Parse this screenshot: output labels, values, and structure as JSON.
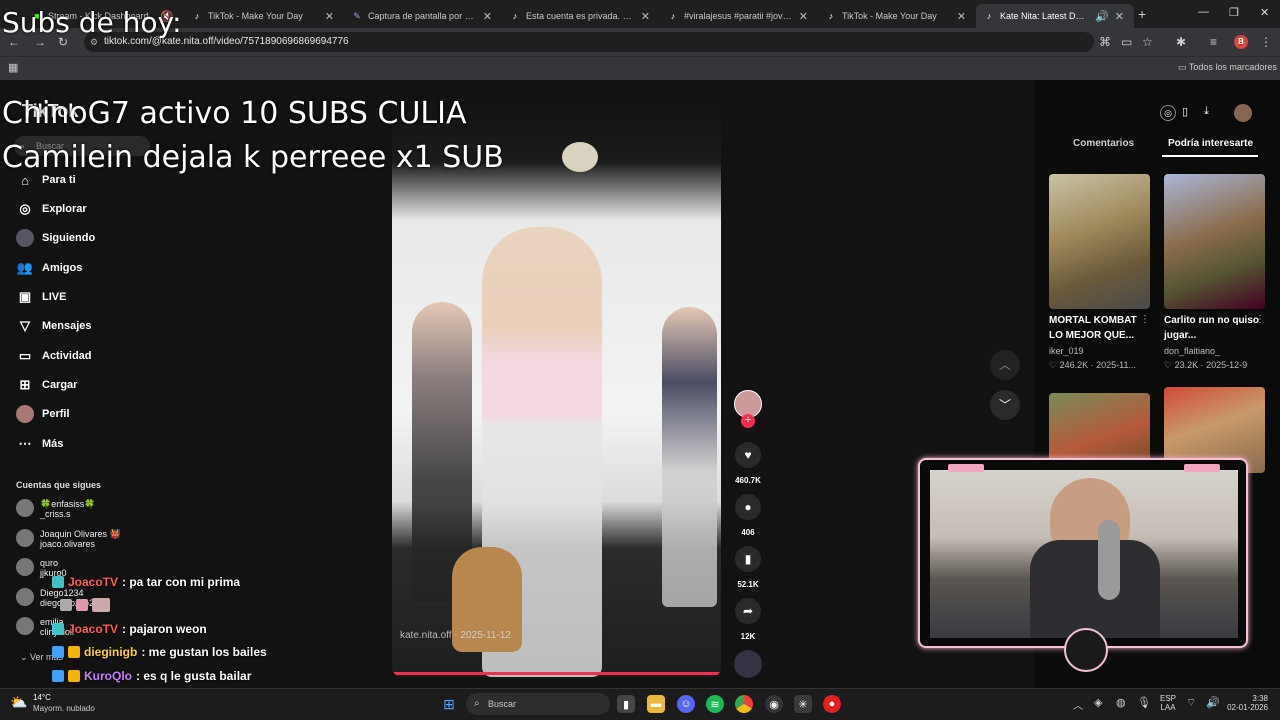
{
  "tabs": [
    {
      "label": "Stream - Kick Dashboard",
      "icon": "kick-icon"
    },
    {
      "label": "TikTok - Make Your Day",
      "icon": "tiktok-icon"
    },
    {
      "label": "Captura de pantalla por Lightshot",
      "icon": "lightshot-icon"
    },
    {
      "label": "Esta cuenta es privada. Sigue e",
      "icon": "tiktok-icon"
    },
    {
      "label": "#viralajesus #paratii #jovenes",
      "icon": "tiktok-icon"
    },
    {
      "label": "TikTok - Make Your Day",
      "icon": "tiktok-icon"
    },
    {
      "label": "Kate Nita: Latest Dances an",
      "icon": "tiktok-icon"
    }
  ],
  "address": {
    "url": "tiktok.com/@kate.nita.off/video/7571890696869694776"
  },
  "bookmarks": {
    "all_label": "Todos los marcadores"
  },
  "profile_letter": "B",
  "sidebar": {
    "logo": "TikTok",
    "search_placeholder": "Buscar",
    "nav": [
      {
        "label": "Para ti",
        "icon": "home-icon"
      },
      {
        "label": "Explorar",
        "icon": "compass-icon"
      },
      {
        "label": "Siguiendo",
        "icon": "following-avatar-icon"
      },
      {
        "label": "Amigos",
        "icon": "friends-icon"
      },
      {
        "label": "LIVE",
        "icon": "live-icon"
      },
      {
        "label": "Mensajes",
        "icon": "messages-icon"
      },
      {
        "label": "Actividad",
        "icon": "activity-icon"
      },
      {
        "label": "Cargar",
        "icon": "upload-icon"
      },
      {
        "label": "Perfil",
        "icon": "profile-avatar-icon"
      },
      {
        "label": "Más",
        "icon": "more-icon"
      }
    ],
    "following_title": "Cuentas que sigues",
    "following": [
      {
        "name": "🍀enfasiss🍀",
        "handle": "_criss.s"
      },
      {
        "name": "Joaquin Olivares 👹",
        "handle": "joaco.olivares"
      },
      {
        "name": "quro",
        "handle": "jjkuro0"
      },
      {
        "name": "Diego1234",
        "handle": "diegoorozco22"
      },
      {
        "name": "emilia",
        "handle": "cliny.doll"
      }
    ],
    "see_more": "Ver más"
  },
  "video": {
    "watermark": "kate.nita.off · 2025-11-12"
  },
  "actions": {
    "likes": "460.7K",
    "comments": "406",
    "saves": "52.1K",
    "shares": "12K"
  },
  "right_panel": {
    "tabs": [
      "Comentarios",
      "Podría interesarte"
    ],
    "cards": [
      {
        "title": "MORTAL KOMBAT LO MEJOR QUE...",
        "author": "iker_019",
        "likes": "246.2K",
        "date": "2025-11..."
      },
      {
        "title": "Carlito run no quiso jugar...",
        "author": "don_flaitiano_",
        "likes": "23.2K",
        "date": "2025-12-9"
      }
    ]
  },
  "overlays": {
    "subs_title": "Subs de hoy:",
    "line1": "ChinoG7 activo 10 SUBS CULIA",
    "line2": "Camilein dejala k perreee x1 SUB"
  },
  "chat": [
    {
      "user": "JoacoTV",
      "msg": ": pa tar con mi prima",
      "color": "#ff5a5a"
    },
    {
      "user": "JoacoTV",
      "msg": ": pajaron weon",
      "color": "#ff5a5a"
    },
    {
      "user": "dieginigb",
      "msg": ": me gustan los bailes",
      "color": "#ffcc33"
    },
    {
      "user": "KuroQlo",
      "msg": ": es q le gusta bailar",
      "color": "#c77dff"
    }
  ],
  "taskbar": {
    "weather_temp": "14°C",
    "weather_desc": "Mayorm. nublado",
    "search_placeholder": "Buscar",
    "lang": "ESP",
    "lang2": "LAA",
    "time": "3:38",
    "date": "02-01-2026"
  }
}
